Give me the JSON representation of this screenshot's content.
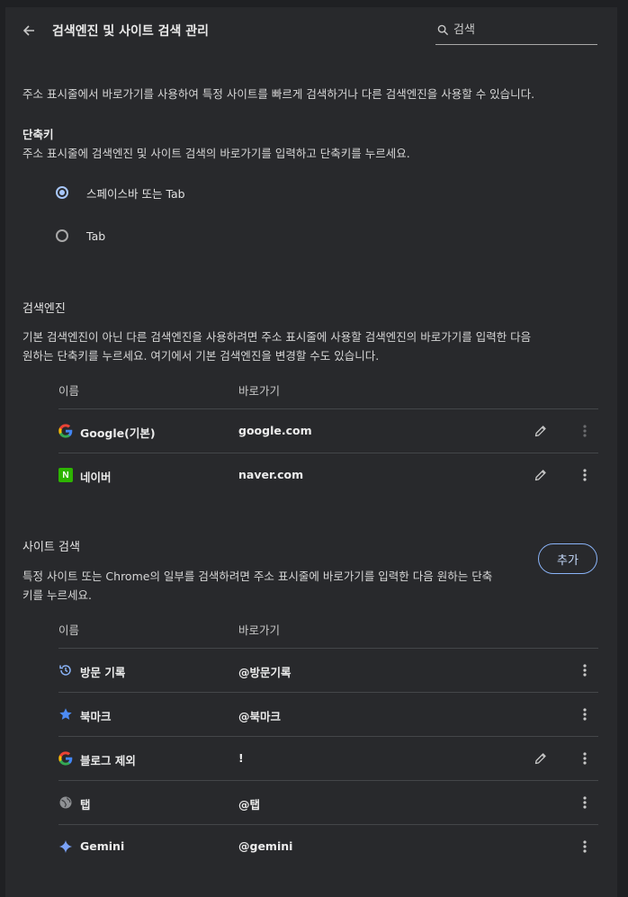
{
  "header": {
    "title": "검색엔진 및 사이트 검색 관리",
    "search_placeholder": "검색"
  },
  "intro": "주소 표시줄에서 바로가기를 사용하여 특정 사이트를 빠르게 검색하거나 다른 검색엔진을 사용할 수 있습니다.",
  "shortcut": {
    "heading": "단축키",
    "description": "주소 표시줄에 검색엔진 및 사이트 검색의 바로가기를 입력하고 단축키를 누르세요.",
    "options": [
      {
        "label": "스페이스바 또는 Tab",
        "selected": true
      },
      {
        "label": "Tab",
        "selected": false
      }
    ]
  },
  "engines": {
    "heading": "검색엔진",
    "description_line1": "기본 검색엔진이 아닌 다른 검색엔진을 사용하려면 주소 표시줄에 사용할 검색엔진의 바로가기를 입력한 다음",
    "description_line2": "원하는 단축키를 누르세요. 여기에서 기본 검색엔진을 변경할 수도 있습니다.",
    "col_name": "이름",
    "col_shortcut": "바로가기",
    "rows": [
      {
        "name": "Google(기본)",
        "shortcut": "google.com",
        "icon": "google-icon"
      },
      {
        "name": "네이버",
        "shortcut": "naver.com",
        "icon": "naver-icon",
        "icon_letter": "N"
      }
    ]
  },
  "sites": {
    "heading": "사이트 검색",
    "add_label": "추가",
    "description_line1": "특정 사이트 또는 Chrome의 일부를 검색하려면 주소 표시줄에 바로가기를 입력한 다음 원하는 단축",
    "description_line2": "키를 누르세요.",
    "col_name": "이름",
    "col_shortcut": "바로가기",
    "rows": [
      {
        "name": "방문 기록",
        "shortcut": "@방문기록",
        "icon": "history-icon"
      },
      {
        "name": "북마크",
        "shortcut": "@북마크",
        "icon": "star-icon"
      },
      {
        "name": "블로그 제외",
        "shortcut": "!",
        "icon": "google-icon"
      },
      {
        "name": "탭",
        "shortcut": "@탭",
        "icon": "globe-icon"
      },
      {
        "name": "Gemini",
        "shortcut": "@gemini",
        "icon": "gemini-icon"
      }
    ]
  },
  "colors": {
    "background": "#28292c",
    "accent": "#a8c7fa",
    "text": "#e3e3e3"
  }
}
